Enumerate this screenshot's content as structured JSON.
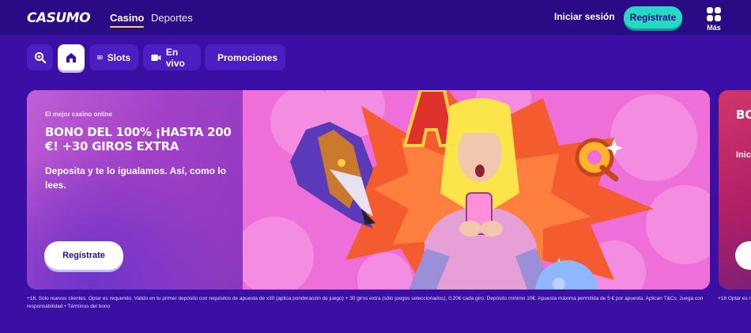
{
  "header": {
    "logo": "CASUMO",
    "nav": [
      "Casino",
      "Deportes"
    ],
    "login_label": "Iniciar sesión",
    "register_label": "Regístrate",
    "more_label": "Más",
    "colors": {
      "bar": "#2b0a86",
      "accent": "#26d9c4",
      "underline": "#ffd046"
    }
  },
  "categories": [
    {
      "icon": "search-icon",
      "label": ""
    },
    {
      "icon": "home-icon",
      "label": "",
      "active": true
    },
    {
      "icon": "slots-icon",
      "label": "Slots"
    },
    {
      "icon": "video-camera-icon",
      "label": "En vivo"
    },
    {
      "icon": "badge-icon",
      "label": "Promociones"
    }
  ],
  "banner": {
    "eyebrow": "El mejor casino online",
    "headline": "BONO DEL 100% ¡HASTA 200 €! +30 GIROS EXTRA",
    "subtitle": "Deposita y te lo igualamos. Así, como lo lees.",
    "cta_label": "Regístrate",
    "legal": "+18. Sólo nuevos clientes. Optar es requerido. Valido en tu primer depósito con requisitos de apuesta de x30 (aplica ponderación de juego) + 30 giros extra (sólo juegos seleccionados), 0,20€ cada giro. Depósito mínimo 10€. Apuesta máxima permitida de 5 € por apuesta. Aplican T&Cs. Juega con responsabilidad • Términos del bono"
  },
  "next_banner": {
    "title_partial": "BO SO",
    "subtitle_partial": "Inic día",
    "legal_partial": "+18 Optar es recompens"
  }
}
